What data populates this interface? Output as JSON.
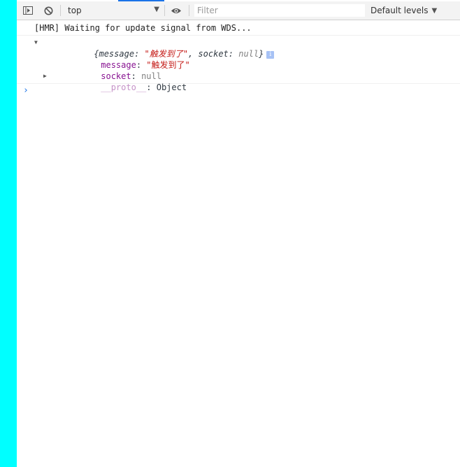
{
  "toolbar": {
    "context_label": "top",
    "filter_placeholder": "Filter",
    "levels_label": "Default levels",
    "icons": [
      "sidebar-toggle-icon",
      "clear-console-icon",
      "eye-icon"
    ]
  },
  "console": {
    "hmr_message": "[HMR] Waiting for update signal from WDS...",
    "object": {
      "summary_open": "{",
      "summary_message_key": "message",
      "summary_colon1": ": ",
      "summary_message_value": "\"触发到了\"",
      "summary_sep": ", ",
      "summary_socket_key": "socket",
      "summary_colon2": ": ",
      "summary_socket_value": "null",
      "summary_close": "}",
      "info_badge": "i",
      "properties": [
        {
          "key": "message",
          "sep": ": ",
          "value": "\"触发到了\""
        },
        {
          "key": "socket",
          "sep": ": ",
          "value": "null"
        },
        {
          "key": "__proto__",
          "sep": ": ",
          "value": "Object"
        }
      ]
    },
    "prompt": "›"
  },
  "colors": {
    "left_strip": "#00ffff",
    "accent": "#1a73e8",
    "key": "#881391",
    "string": "#c41a16",
    "null": "#808080"
  }
}
